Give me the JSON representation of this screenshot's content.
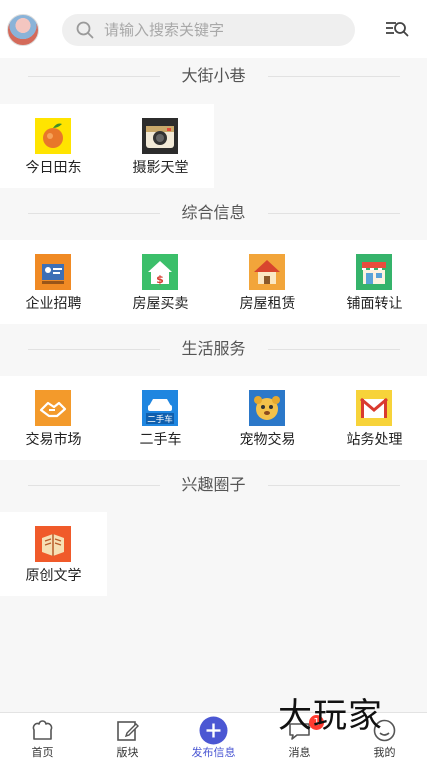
{
  "header": {
    "search_placeholder": "请输入搜索关键字",
    "icons": {
      "search": "search-icon",
      "filter": "list-search-icon",
      "avatar": "user-avatar"
    }
  },
  "sections": [
    {
      "title": "大街小巷",
      "items": [
        {
          "label": "今日田东",
          "icon": "orange-fruit-icon"
        },
        {
          "label": "摄影天堂",
          "icon": "camera-icon"
        }
      ]
    },
    {
      "title": "综合信息",
      "items": [
        {
          "label": "企业招聘",
          "icon": "recruitment-icon"
        },
        {
          "label": "房屋买卖",
          "icon": "house-sale-icon"
        },
        {
          "label": "房屋租赁",
          "icon": "house-rent-icon"
        },
        {
          "label": "铺面转让",
          "icon": "shop-icon"
        }
      ]
    },
    {
      "title": "生活服务",
      "items": [
        {
          "label": "交易市场",
          "icon": "handshake-icon"
        },
        {
          "label": "二手车",
          "icon": "used-car-icon",
          "icon_text": "二手车"
        },
        {
          "label": "宠物交易",
          "icon": "pet-icon"
        },
        {
          "label": "站务处理",
          "icon": "mail-icon"
        }
      ]
    },
    {
      "title": "兴趣圈子",
      "items": [
        {
          "label": "原创文学",
          "icon": "book-icon"
        }
      ]
    }
  ],
  "bottom_nav": {
    "items": [
      {
        "label": "首页",
        "icon": "home-icon"
      },
      {
        "label": "版块",
        "icon": "edit-board-icon"
      },
      {
        "label": "发布信息",
        "icon": "plus-circle-icon",
        "active": true
      },
      {
        "label": "消息",
        "icon": "chat-icon",
        "badge": "1"
      },
      {
        "label": "我的",
        "icon": "profile-icon"
      }
    ]
  },
  "watermark": "大玩家",
  "colors": {
    "accent": "#4b57d3",
    "background": "#f7f7f7",
    "badge": "#ff3b30"
  }
}
